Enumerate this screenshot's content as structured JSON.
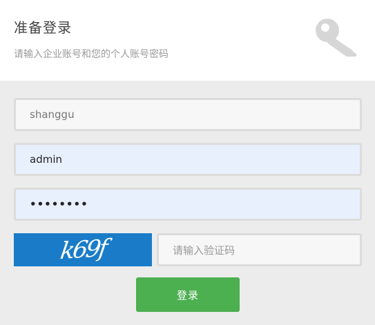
{
  "header": {
    "title": "准备登录",
    "subtitle": "请输入企业账号和您的个人账号密码",
    "icon": "key-icon"
  },
  "form": {
    "company_value": "shanggu",
    "username_value": "admin",
    "password_value": "••••••••",
    "captcha_image_text": "k69f",
    "captcha_placeholder": "请输入验证码",
    "login_label": "登录"
  },
  "colors": {
    "background": "#ececec",
    "header_bg": "#ffffff",
    "input_border": "#dcdcdc",
    "autofill_bg": "#e8f0fe",
    "captcha_bg": "#1a7cc8",
    "button_bg": "#4caf50"
  }
}
